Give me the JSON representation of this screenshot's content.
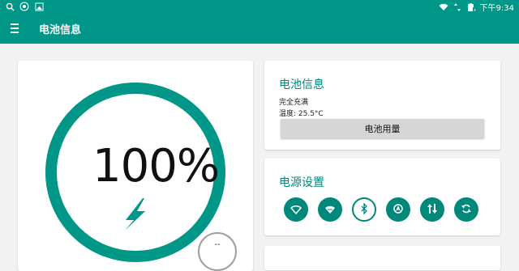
{
  "statusbar": {
    "left_icons": [
      "search-icon",
      "settings-badge-icon",
      "image-icon"
    ],
    "right_icons": [
      "wifi-icon",
      "data-arrows-icon",
      "battery-full-icon"
    ],
    "time": "下午9:34"
  },
  "toolbar": {
    "menu_icon": "menu-icon",
    "title": "电池信息"
  },
  "battery": {
    "percent": "100%",
    "status_icon": "charging-bolt-icon",
    "ring_color": "#009688",
    "fab_label": "--"
  },
  "info_card": {
    "title": "电池信息",
    "status": "完全充满",
    "temperature": "温度: 25.5°C",
    "usage_button": "电池用量"
  },
  "power_card": {
    "title": "电源设置",
    "toggles": [
      {
        "icon": "wifi-icon",
        "on": true
      },
      {
        "icon": "hotspot-icon",
        "on": true
      },
      {
        "icon": "bluetooth-icon",
        "on": false
      },
      {
        "icon": "location-icon",
        "on": true
      },
      {
        "icon": "mobile-data-icon",
        "on": true
      },
      {
        "icon": "auto-rotate-icon",
        "on": true
      }
    ]
  },
  "colors": {
    "accent": "#009688",
    "title_accent": "#00897b",
    "background": "#f2f2f2"
  }
}
